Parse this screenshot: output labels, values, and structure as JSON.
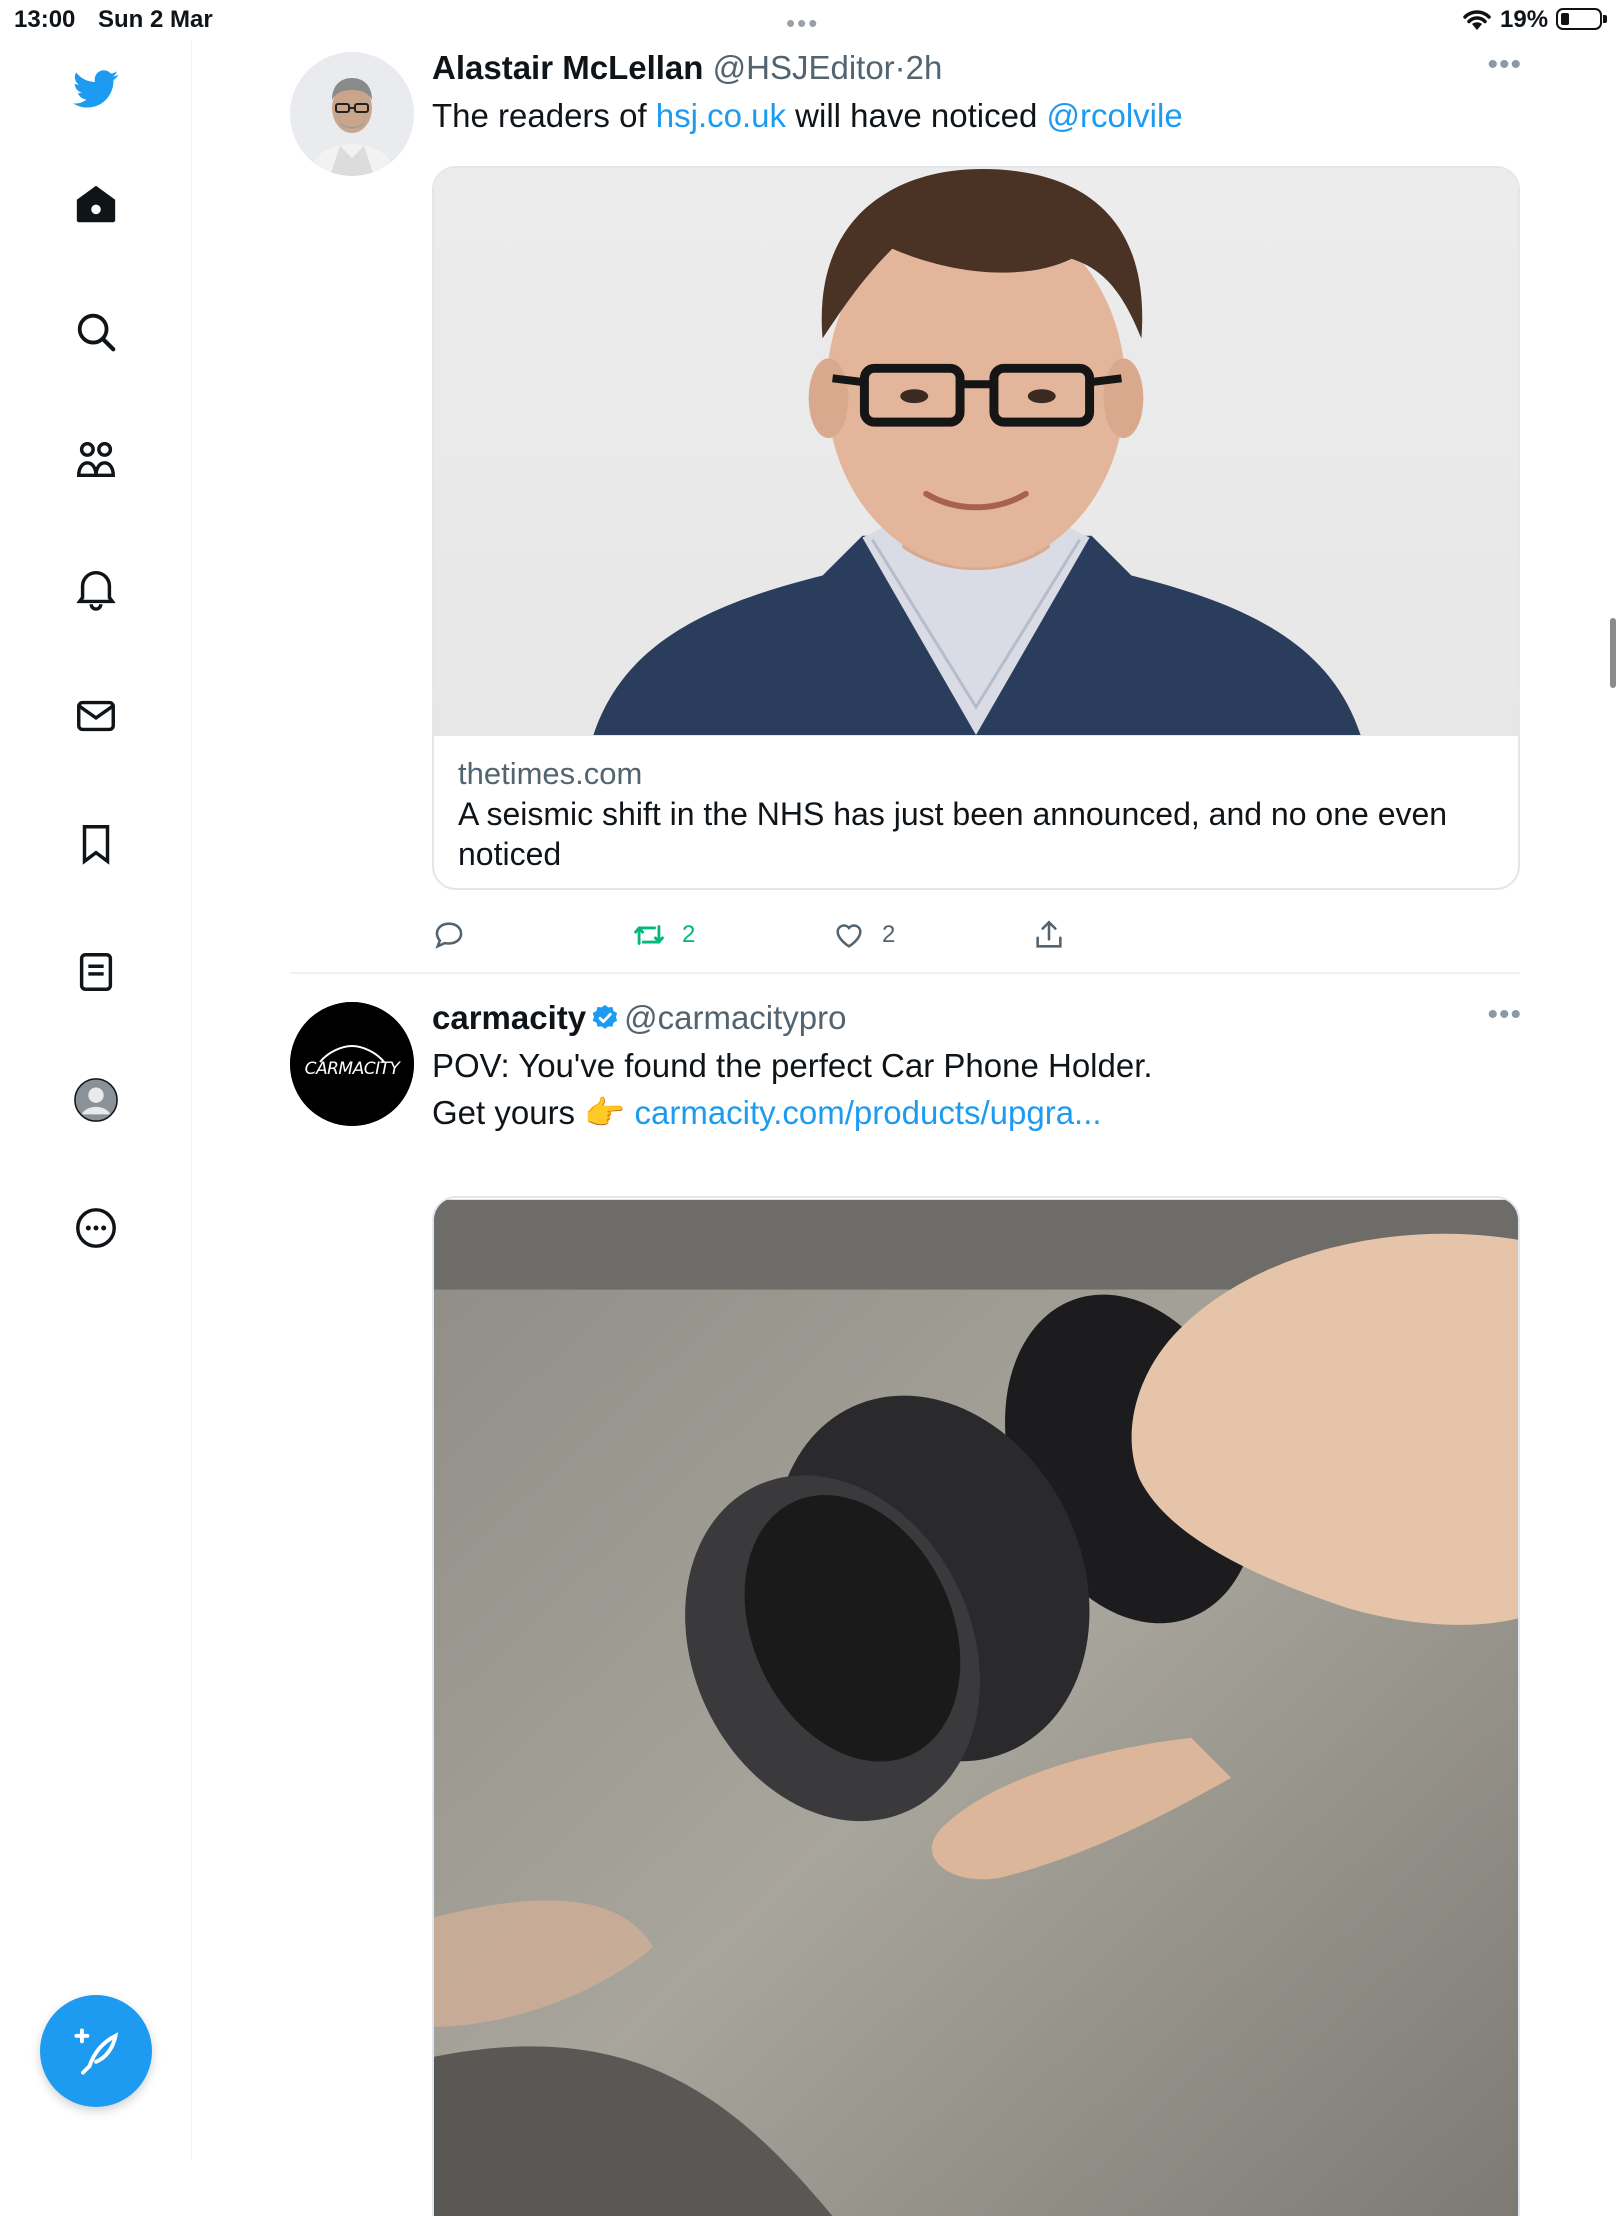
{
  "status_bar": {
    "time": "13:00",
    "date": "Sun 2 Mar",
    "battery": "19%"
  },
  "sidebar": {
    "items": [
      {
        "icon": "twitter-bird-icon"
      },
      {
        "icon": "home-icon"
      },
      {
        "icon": "search-icon"
      },
      {
        "icon": "communities-icon"
      },
      {
        "icon": "bell-icon"
      },
      {
        "icon": "mail-icon"
      },
      {
        "icon": "bookmark-icon"
      },
      {
        "icon": "lists-icon"
      },
      {
        "icon": "profile-avatar-icon"
      },
      {
        "icon": "more-circle-icon"
      }
    ],
    "compose_icon": "compose-feather-icon",
    "accent": "#1d9bf0"
  },
  "tweets": [
    {
      "author": "Alastair McLellan",
      "handle": "@HSJEditor",
      "separator": "·",
      "time": "2h",
      "text_before": "The readers of ",
      "link1": "hsj.co.uk",
      "text_middle": " will have noticed ",
      "link2": "@rcolvile",
      "card": {
        "domain": "thetimes.com",
        "title": "A seismic shift in the NHS has just been announced, and no one even noticed"
      },
      "actions": {
        "retweets": "2",
        "likes": "2"
      }
    },
    {
      "author": "carmacity",
      "handle": "@carmacitypro",
      "avatar_text": "CARMACITY",
      "line1": "POV: You've found the perfect Car Phone Holder.",
      "line2_before": "Get yours ",
      "emoji": "👉",
      "link": "carmacity.com/products/upgra..."
    }
  ]
}
